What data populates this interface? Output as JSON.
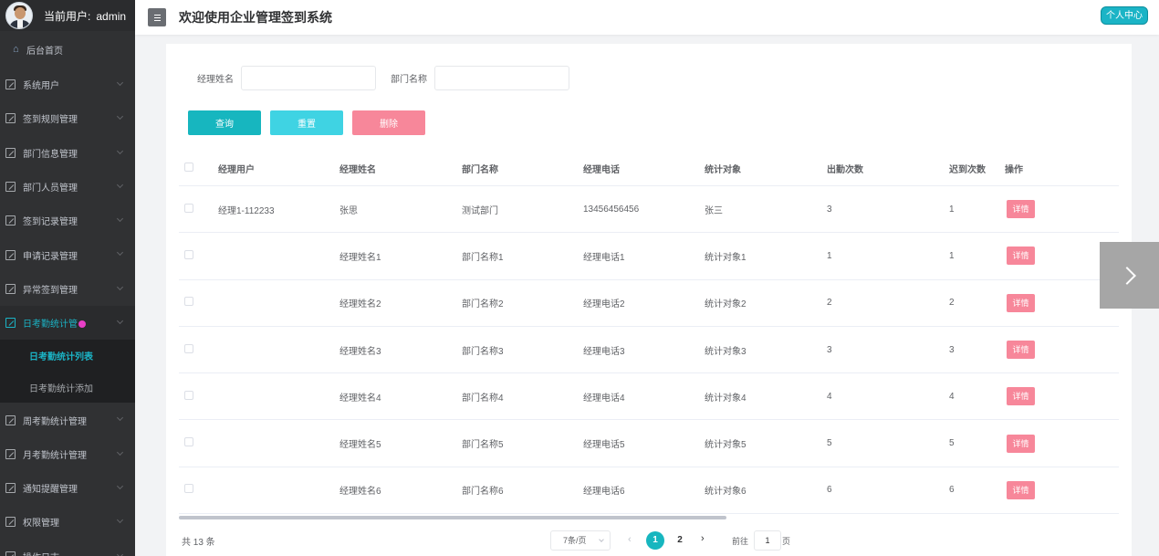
{
  "user": {
    "label": "当前用户:",
    "name": "admin"
  },
  "header": {
    "title": "欢迎使用企业管理签到系统",
    "personal_center": "个人中心"
  },
  "sidebar": {
    "home": "后台首页",
    "items": [
      {
        "label": "系统用户"
      },
      {
        "label": "签到规则管理"
      },
      {
        "label": "部门信息管理"
      },
      {
        "label": "部门人员管理"
      },
      {
        "label": "签到记录管理"
      },
      {
        "label": "申请记录管理"
      },
      {
        "label": "异常签到管理"
      },
      {
        "label": "日考勤统计管"
      },
      {
        "label": "周考勤统计管理"
      },
      {
        "label": "月考勤统计管理"
      },
      {
        "label": "通知提醒管理"
      },
      {
        "label": "权限管理"
      },
      {
        "label": "操作日志"
      }
    ],
    "submenu": [
      {
        "label": "日考勤统计列表"
      },
      {
        "label": "日考勤统计添加"
      }
    ]
  },
  "search": {
    "manager_name_label": "经理姓名",
    "dept_name_label": "部门名称",
    "search_btn": "查询",
    "reset_btn": "重置",
    "delete_btn": "删除"
  },
  "table": {
    "headers": [
      "经理用户",
      "经理姓名",
      "部门名称",
      "经理电话",
      "统计对象",
      "出勤次数",
      "迟到次数",
      "操作"
    ],
    "detail_label": "详情",
    "rows": [
      {
        "user": "经理1-112233",
        "name": "张思",
        "dept": "测试部门",
        "phone": "13456456456",
        "target": "张三",
        "attend": "3",
        "late": "1"
      },
      {
        "user": "",
        "name": "经理姓名1",
        "dept": "部门名称1",
        "phone": "经理电话1",
        "target": "统计对象1",
        "attend": "1",
        "late": "1"
      },
      {
        "user": "",
        "name": "经理姓名2",
        "dept": "部门名称2",
        "phone": "经理电话2",
        "target": "统计对象2",
        "attend": "2",
        "late": "2"
      },
      {
        "user": "",
        "name": "经理姓名3",
        "dept": "部门名称3",
        "phone": "经理电话3",
        "target": "统计对象3",
        "attend": "3",
        "late": "3"
      },
      {
        "user": "",
        "name": "经理姓名4",
        "dept": "部门名称4",
        "phone": "经理电话4",
        "target": "统计对象4",
        "attend": "4",
        "late": "4"
      },
      {
        "user": "",
        "name": "经理姓名5",
        "dept": "部门名称5",
        "phone": "经理电话5",
        "target": "统计对象5",
        "attend": "5",
        "late": "5"
      },
      {
        "user": "",
        "name": "经理姓名6",
        "dept": "部门名称6",
        "phone": "经理电话6",
        "target": "统计对象6",
        "attend": "6",
        "late": "6"
      }
    ]
  },
  "pagination": {
    "total": "共 13 条",
    "page_size": "7条/页",
    "pages": [
      "1",
      "2"
    ],
    "goto_label": "前往",
    "goto_value": "1",
    "goto_unit": "页"
  },
  "colors": {
    "accent": "#1bb4c6",
    "delete": "#f7879a",
    "sidebar_bg": "#303133"
  },
  "icons": {
    "next_slide": "chevron-right-icon"
  }
}
